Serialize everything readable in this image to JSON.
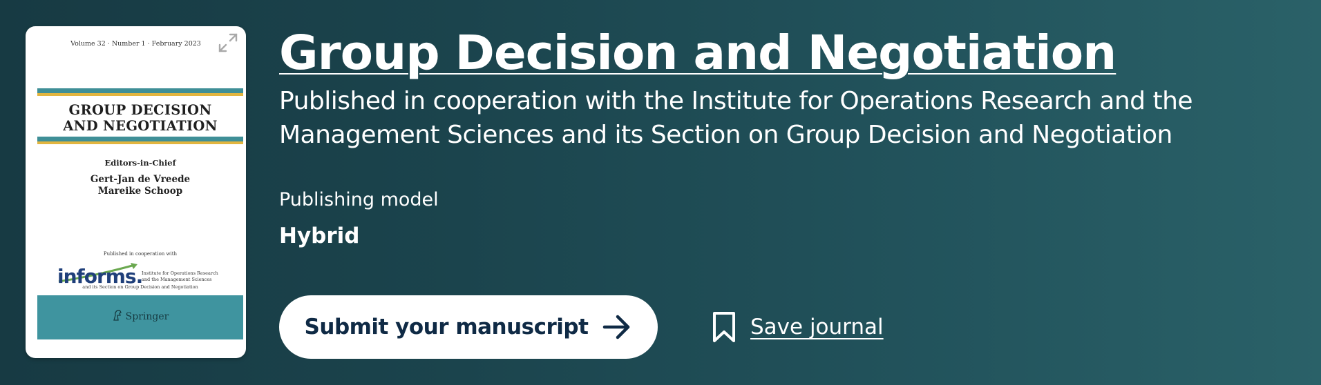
{
  "cover": {
    "volume_line": "Volume 32 · Number 1 · February 2023",
    "title_line1": "GROUP DECISION",
    "title_line2": "AND NEGOTIATION",
    "editors_label": "Editors-in-Chief",
    "editor1": "Gert-Jan de Vreede",
    "editor2": "Mareike Schoop",
    "published_with": "Published in cooperation with",
    "informs_logo": "informs.",
    "informs_desc_line1": "Institute for Operations Research",
    "informs_desc_line2": "and the Management Sciences",
    "section_line": "and its Section on Group Decision and Negotiation",
    "publisher": "Springer",
    "expand_icon": "expand-icon"
  },
  "header": {
    "title": "Group Decision and Negotiation",
    "subtitle": "Published in cooperation with the Institute for Operations Research and the Management Sciences and its Section on Group Decision and Negotiation"
  },
  "publishing_model": {
    "label": "Publishing model",
    "value": "Hybrid"
  },
  "actions": {
    "submit_label": "Submit your manuscript",
    "submit_icon": "arrow-right-icon",
    "save_label": "Save journal",
    "save_icon": "bookmark-icon"
  },
  "colors": {
    "background_start": "#173a43",
    "background_end": "#2a6168",
    "button_text": "#0f2a45",
    "cover_teal": "#3f8f97",
    "cover_gold": "#e2b53f"
  }
}
